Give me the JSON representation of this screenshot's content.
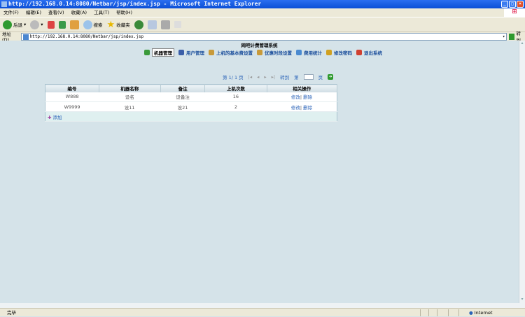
{
  "window": {
    "title": "http://192.168.0.14:8080/Netbar/jsp/index.jsp - Microsoft Internet Explorer"
  },
  "menu": [
    "文件(F)",
    "编辑(E)",
    "查看(V)",
    "收藏(A)",
    "工具(T)",
    "帮助(H)"
  ],
  "toolbar": {
    "back": "后退",
    "search": "搜索",
    "favorites": "收藏夹"
  },
  "address": {
    "label": "地址(D)",
    "url": "http://192.168.0.14:8080/Netbar/jsp/index.jsp",
    "go": "转到"
  },
  "page": {
    "title": "网吧计费管理系统",
    "nav": [
      {
        "label": "机器管理",
        "color": "#3a9a3a"
      },
      {
        "label": "用户管理",
        "color": "#3b5fa8"
      },
      {
        "label": "上机的基本费设置",
        "color": "#c89a3a"
      },
      {
        "label": "优惠时段设置",
        "color": "#c89a3a"
      },
      {
        "label": "费用统计",
        "color": "#4a8ad0"
      },
      {
        "label": "修改密码",
        "color": "#d0a020"
      },
      {
        "label": "退出系统",
        "color": "#d04030"
      }
    ],
    "pager": {
      "info": "第 1/ 1 页",
      "first": "|◂",
      "prev": "◂",
      "next": "▸",
      "last": "▸|",
      "goto": "转到",
      "di": "第",
      "ye": "页"
    },
    "table": {
      "headers": [
        "编号",
        "机器名称",
        "备注",
        "上机次数",
        "相关操作"
      ],
      "rows": [
        [
          "W888",
          "设名",
          "设备注",
          "16"
        ],
        [
          "W9999",
          "设11",
          "设21",
          "2"
        ]
      ],
      "edit": "修改",
      "sep": "|",
      "delete": "删除",
      "add": "添加"
    }
  },
  "status": {
    "left": "完毕",
    "zone": "Internet"
  }
}
